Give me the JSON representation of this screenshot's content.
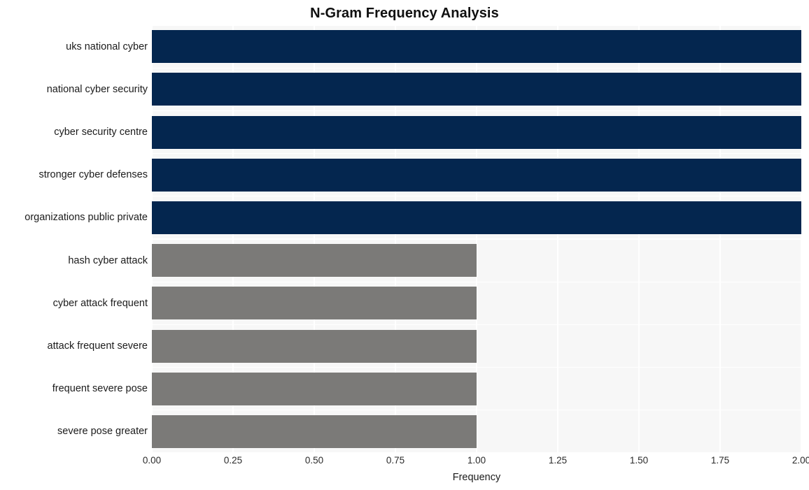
{
  "chart_data": {
    "type": "bar",
    "orientation": "horizontal",
    "title": "N-Gram Frequency Analysis",
    "xlabel": "Frequency",
    "ylabel": "",
    "xlim": [
      0,
      2
    ],
    "ylim": null,
    "grid": true,
    "legend": null,
    "xticks": [
      "0.00",
      "0.25",
      "0.50",
      "0.75",
      "1.00",
      "1.25",
      "1.50",
      "1.75",
      "2.00"
    ],
    "xtick_values": [
      0,
      0.25,
      0.5,
      0.75,
      1,
      1.25,
      1.5,
      1.75,
      2
    ],
    "categories": [
      "uks national cyber",
      "national cyber security",
      "cyber security centre",
      "stronger cyber defenses",
      "organizations public private",
      "hash cyber attack",
      "cyber attack frequent",
      "attack frequent severe",
      "frequent severe pose",
      "severe pose greater"
    ],
    "values": [
      2,
      2,
      2,
      2,
      2,
      1,
      1,
      1,
      1,
      1
    ],
    "bar_colors": [
      "#04264f",
      "#04264f",
      "#04264f",
      "#04264f",
      "#04264f",
      "#7b7a78",
      "#7b7a78",
      "#7b7a78",
      "#7b7a78",
      "#7b7a78"
    ]
  },
  "style": {
    "plot_background": "#f7f7f7",
    "figure_background": "#ffffff",
    "gridline_color": "#ffffff",
    "high_value_color": "#04264f",
    "low_value_color": "#7b7a78",
    "title_color": "#101010",
    "tick_color": "#2a2a2a"
  }
}
